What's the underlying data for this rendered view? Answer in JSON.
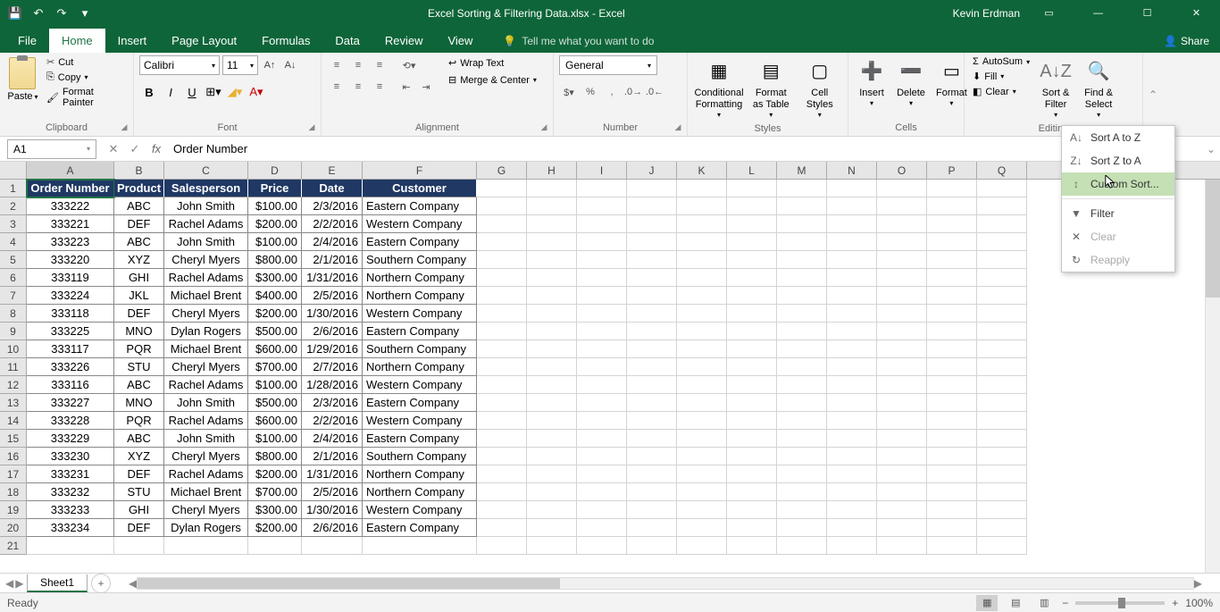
{
  "title": "Excel Sorting & Filtering Data.xlsx - Excel",
  "username": "Kevin Erdman",
  "share": "Share",
  "tabs": [
    "File",
    "Home",
    "Insert",
    "Page Layout",
    "Formulas",
    "Data",
    "Review",
    "View"
  ],
  "tell_me": "Tell me what you want to do",
  "ribbon": {
    "clipboard": {
      "label": "Clipboard",
      "paste": "Paste",
      "cut": "Cut",
      "copy": "Copy",
      "fp": "Format Painter"
    },
    "font": {
      "label": "Font",
      "name": "Calibri",
      "size": "11"
    },
    "alignment": {
      "label": "Alignment",
      "wrap": "Wrap Text",
      "merge": "Merge & Center"
    },
    "number": {
      "label": "Number",
      "format": "General"
    },
    "styles": {
      "label": "Styles",
      "cond": "Conditional Formatting",
      "table": "Format as Table",
      "cell": "Cell Styles"
    },
    "cells": {
      "label": "Cells",
      "insert": "Insert",
      "delete": "Delete",
      "format": "Format"
    },
    "editing": {
      "label": "Editing",
      "autosum": "AutoSum",
      "fill": "Fill",
      "clear": "Clear",
      "sort": "Sort & Filter",
      "find": "Find & Select"
    }
  },
  "dropdown": {
    "sort_az": "Sort A to Z",
    "sort_za": "Sort Z to A",
    "custom": "Custom Sort...",
    "filter": "Filter",
    "clear": "Clear",
    "reapply": "Reapply"
  },
  "name_box": "A1",
  "formula": "Order Number",
  "columns": [
    "A",
    "B",
    "C",
    "D",
    "E",
    "F",
    "G",
    "H",
    "I",
    "J",
    "K",
    "L",
    "M",
    "N",
    "O",
    "P",
    "Q"
  ],
  "col_widths": [
    "wA",
    "wB",
    "wC",
    "wD",
    "wE",
    "wF",
    "wG",
    "wH",
    "wI",
    "wJ",
    "wK",
    "wL",
    "wM",
    "wN",
    "wO",
    "wP",
    "wQ"
  ],
  "headers": [
    "Order Number",
    "Product",
    "Salesperson",
    "Price",
    "Date",
    "Customer"
  ],
  "rows": [
    [
      "333222",
      "ABC",
      "John Smith",
      "$100.00",
      "2/3/2016",
      "Eastern Company"
    ],
    [
      "333221",
      "DEF",
      "Rachel Adams",
      "$200.00",
      "2/2/2016",
      "Western Company"
    ],
    [
      "333223",
      "ABC",
      "John Smith",
      "$100.00",
      "2/4/2016",
      "Eastern Company"
    ],
    [
      "333220",
      "XYZ",
      "Cheryl Myers",
      "$800.00",
      "2/1/2016",
      "Southern Company"
    ],
    [
      "333119",
      "GHI",
      "Rachel Adams",
      "$300.00",
      "1/31/2016",
      "Northern Company"
    ],
    [
      "333224",
      "JKL",
      "Michael Brent",
      "$400.00",
      "2/5/2016",
      "Northern Company"
    ],
    [
      "333118",
      "DEF",
      "Cheryl Myers",
      "$200.00",
      "1/30/2016",
      "Western Company"
    ],
    [
      "333225",
      "MNO",
      "Dylan Rogers",
      "$500.00",
      "2/6/2016",
      "Eastern Company"
    ],
    [
      "333117",
      "PQR",
      "Michael Brent",
      "$600.00",
      "1/29/2016",
      "Southern Company"
    ],
    [
      "333226",
      "STU",
      "Cheryl Myers",
      "$700.00",
      "2/7/2016",
      "Northern Company"
    ],
    [
      "333116",
      "ABC",
      "Rachel Adams",
      "$100.00",
      "1/28/2016",
      "Western Company"
    ],
    [
      "333227",
      "MNO",
      "John Smith",
      "$500.00",
      "2/3/2016",
      "Eastern Company"
    ],
    [
      "333228",
      "PQR",
      "Rachel Adams",
      "$600.00",
      "2/2/2016",
      "Western Company"
    ],
    [
      "333229",
      "ABC",
      "John Smith",
      "$100.00",
      "2/4/2016",
      "Eastern Company"
    ],
    [
      "333230",
      "XYZ",
      "Cheryl Myers",
      "$800.00",
      "2/1/2016",
      "Southern Company"
    ],
    [
      "333231",
      "DEF",
      "Rachel Adams",
      "$200.00",
      "1/31/2016",
      "Northern Company"
    ],
    [
      "333232",
      "STU",
      "Michael Brent",
      "$700.00",
      "2/5/2016",
      "Northern Company"
    ],
    [
      "333233",
      "GHI",
      "Cheryl Myers",
      "$300.00",
      "1/30/2016",
      "Western Company"
    ],
    [
      "333234",
      "DEF",
      "Dylan Rogers",
      "$200.00",
      "2/6/2016",
      "Eastern Company"
    ]
  ],
  "sheet": "Sheet1",
  "status": "Ready",
  "zoom": "100%"
}
